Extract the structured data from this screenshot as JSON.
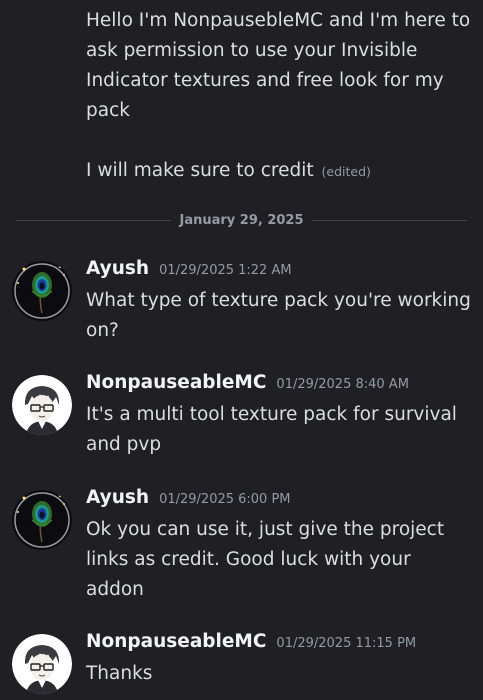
{
  "continued_message": {
    "lines": [
      "Hello I'm NonpausebleMC and I'm here to",
      "ask permission to use your Invisible",
      "Indicator textures and free look for my",
      "pack"
    ],
    "last_line": "I will make sure to credit",
    "edited_label": "(edited)"
  },
  "date_divider": {
    "label": "January 29, 2025"
  },
  "messages": [
    {
      "username": "Ayush",
      "timestamp": "01/29/2025 1:22 AM",
      "avatar_icon": "peacock-feather-avatar",
      "lines": [
        "What type of texture pack you're working",
        "on?"
      ]
    },
    {
      "username": "NonpauseableMC",
      "timestamp": "01/29/2025 8:40 AM",
      "avatar_icon": "anime-character-avatar",
      "lines": [
        "It's a multi tool texture pack for survival",
        "and pvp"
      ]
    },
    {
      "username": "Ayush",
      "timestamp": "01/29/2025 6:00 PM",
      "avatar_icon": "peacock-feather-avatar",
      "lines": [
        "Ok you can use it, just give the project",
        "links as credit. Good luck with your",
        "addon"
      ]
    },
    {
      "username": "NonpauseableMC",
      "timestamp": "01/29/2025 11:15 PM",
      "avatar_icon": "anime-character-avatar",
      "lines": [
        "Thanks"
      ]
    }
  ],
  "colors": {
    "background": "#1f1f24",
    "text": "#dbdee1",
    "username": "#f2f3f5",
    "muted": "#949ba4",
    "divider": "#3f4147"
  }
}
